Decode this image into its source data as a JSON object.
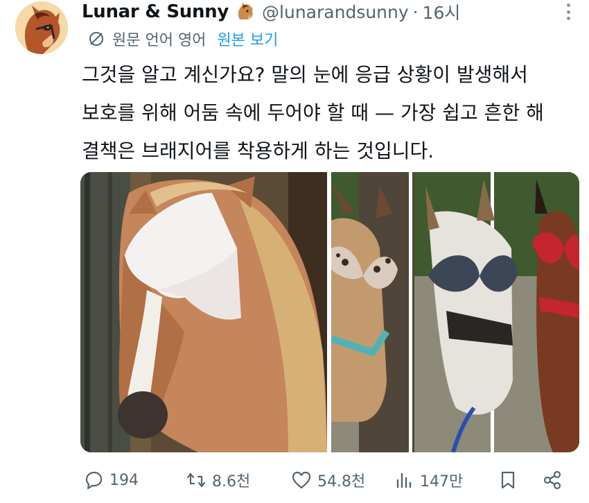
{
  "author": {
    "display_name": "Lunar & Sunny",
    "name_emoji": "horse-face-icon",
    "handle": "@lunarandsunny",
    "separator": "·",
    "time": "16시"
  },
  "translation": {
    "label": "원문 언어 영어",
    "show_original": "원본 보기"
  },
  "tweet": {
    "lines": [
      "그것을 알고 계신가요? 말의 눈에 응급 상황이 발생해서",
      "보호를 위해 어둠 속에 두어야 할 때 — 가장 쉽고 흔한 해",
      "결책은 브래지어를 착용하게 하는 것입니다."
    ]
  },
  "actions": {
    "replies": "194",
    "retweets": "8.6천",
    "likes": "54.8천",
    "views": "147만"
  },
  "colors": {
    "accent": "#1d9bf0",
    "muted": "#536471"
  }
}
